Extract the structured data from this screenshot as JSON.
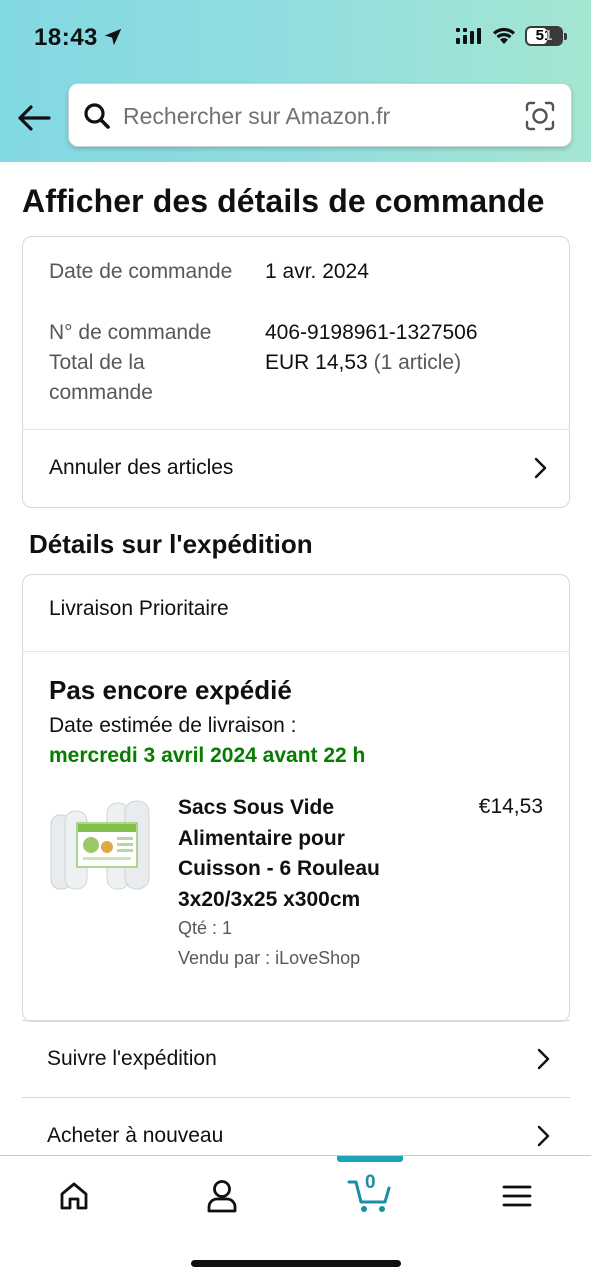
{
  "status_bar": {
    "time": "18:43",
    "battery": "51"
  },
  "search": {
    "placeholder": "Rechercher sur Amazon.fr"
  },
  "page": {
    "title": "Afficher des détails de commande"
  },
  "order_summary": {
    "date_label": "Date de commande",
    "date_value": "1 avr. 2024",
    "number_label": "N° de commande",
    "number_value": "406-9198961-1327506",
    "total_label": "Total de la commande",
    "total_value": "EUR 14,53",
    "total_items": "(1 article)",
    "cancel_link": "Annuler des articles"
  },
  "shipping": {
    "section_title": "Détails sur l'expédition",
    "method": "Livraison Prioritaire",
    "status": "Pas encore expédié",
    "eta_label": "Date estimée de livraison :",
    "eta_date": "mercredi 3 avril 2024 avant 22 h",
    "item": {
      "title": "Sacs Sous Vide Alimentaire pour Cuisson - 6 Rouleau 3x20/3x25 x300cm",
      "price": "€14,53",
      "qty": "Qté : 1",
      "seller": "Vendu par : iLoveShop"
    },
    "track_link": "Suivre l'expédition",
    "buy_again_link": "Acheter à nouveau"
  },
  "bottom_nav": {
    "cart_count": "0",
    "items": [
      "home-icon",
      "account-icon",
      "cart-icon",
      "menu-icon"
    ]
  },
  "colors": {
    "accent_green": "#067d00",
    "cart_teal": "#1ba3b5"
  }
}
